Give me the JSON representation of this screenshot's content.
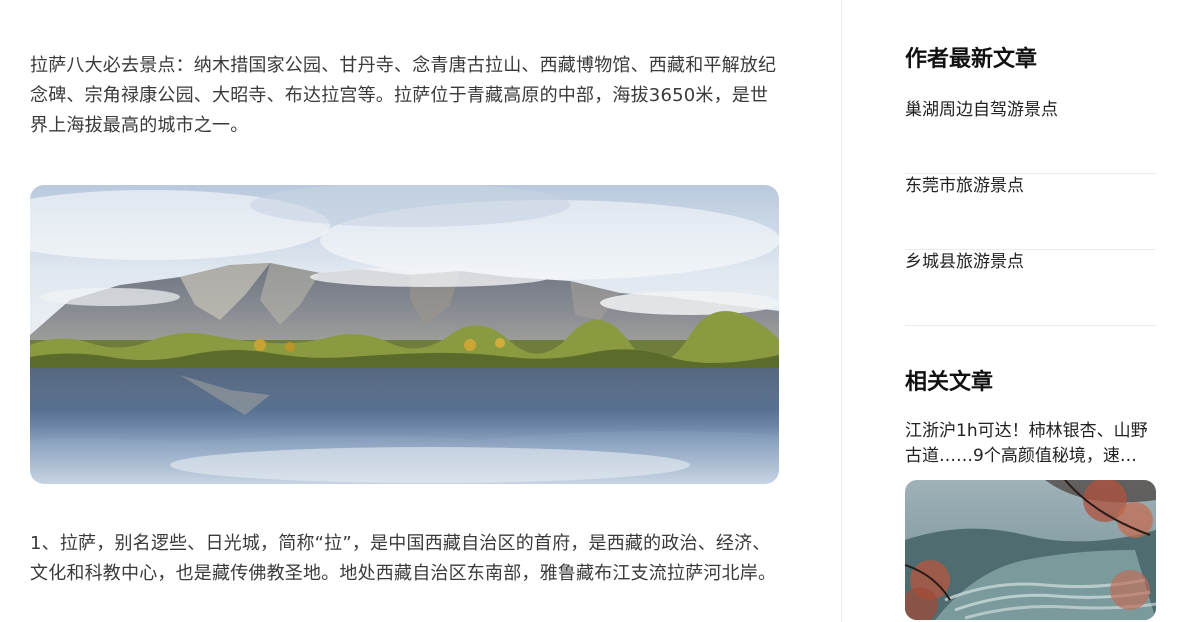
{
  "article": {
    "intro": "拉萨八大必去景点：纳木措国家公园、甘丹寺、念青唐古拉山、西藏博物馆、西藏和平解放纪念碑、宗角禄康公园、大昭寺、布达拉宫等。拉萨位于青藏高原的中部，海拔3650米，是世界上海拔最高的城市之一。",
    "image_subject": "lake-mountain-photo",
    "item_1": "1、拉萨，别名逻些、日光城，简称“拉”，是中国西藏自治区的首府，是西藏的政治、经济、文化和科教中心，也是藏传佛教圣地。地处西藏自治区东南部，雅鲁藏布江支流拉萨河北岸。"
  },
  "sidebar": {
    "author_heading": "作者最新文章",
    "latest": [
      {
        "title": "巢湖周边自驾游景点"
      },
      {
        "title": "东莞市旅游景点"
      },
      {
        "title": "乡城县旅游景点"
      }
    ],
    "related_heading": "相关文章",
    "related": [
      {
        "title": "江浙沪1h可达！柿林银杏、山野古道……9个高颜值秘境，速…"
      }
    ]
  },
  "colors": {
    "text": "#3a3a3a",
    "heading": "#111111",
    "divider": "#ececec"
  }
}
